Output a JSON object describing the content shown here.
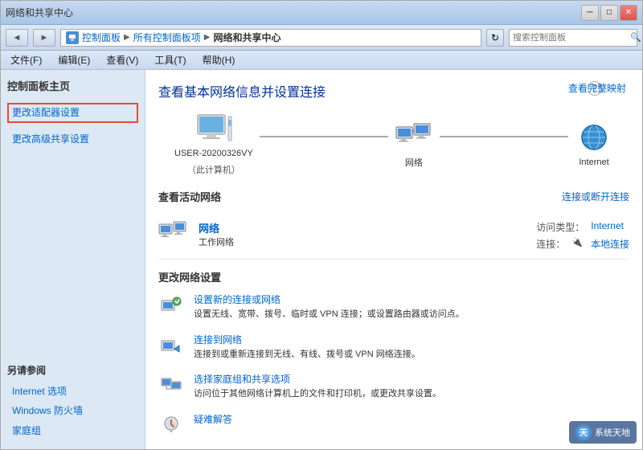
{
  "window": {
    "title": "网络和共享中心"
  },
  "titlebar": {
    "min_label": "─",
    "max_label": "□",
    "close_label": "✕"
  },
  "addressbar": {
    "bc_icon_label": "⚙",
    "bc_part1": "控制面板",
    "bc_part2": "所有控制面板项",
    "bc_part3": "网络和共享中心",
    "refresh_label": "↻",
    "search_placeholder": "搜索控制面板",
    "nav_back": "◄",
    "nav_fwd": "►"
  },
  "menubar": {
    "items": [
      {
        "label": "文件(F)"
      },
      {
        "label": "编辑(E)"
      },
      {
        "label": "查看(V)"
      },
      {
        "label": "工具(T)"
      },
      {
        "label": "帮助(H)"
      }
    ]
  },
  "sidebar": {
    "title": "控制面板主页",
    "links": [
      {
        "label": "更改适配器设置",
        "active": true
      },
      {
        "label": "更改高级共享设置"
      }
    ],
    "also_section": {
      "title": "另请参阅",
      "links": [
        {
          "label": "Internet 选项"
        },
        {
          "label": "Windows 防火墙"
        },
        {
          "label": "家庭组"
        }
      ]
    }
  },
  "content": {
    "title": "查看基本网络信息并设置连接",
    "view_full_map": "查看完整映射",
    "network_diagram": {
      "nodes": [
        {
          "label": "USER-20200326VY",
          "sublabel": "（此计算机）"
        },
        {
          "label": "网络",
          "sublabel": ""
        },
        {
          "label": "Internet",
          "sublabel": ""
        }
      ]
    },
    "active_network": {
      "section_title": "查看活动网络",
      "connect_link": "连接或断开连接",
      "network_name": "网络",
      "network_type": "工作网络",
      "access_type_label": "访问类型：",
      "access_type_value": "Internet",
      "connect_label": "连接：",
      "connect_value": "本地连接",
      "connect_icon": "🔌"
    },
    "change_settings": {
      "title": "更改网络设置",
      "items": [
        {
          "link": "设置新的连接或网络",
          "desc": "设置无线、宽带、拨号、临时或 VPN 连接；或设置路由器或访问点。"
        },
        {
          "link": "连接到网络",
          "desc": "连接到或重新连接到无线、有线、拨号或 VPN 网络连接。"
        },
        {
          "link": "选择家庭组和共享选项",
          "desc": "访问位于其他网络计算机上的文件和打印机，或更改共享设置。"
        },
        {
          "link": "疑难解答",
          "desc": ""
        }
      ]
    }
  },
  "watermark": {
    "text": "系统天地"
  }
}
